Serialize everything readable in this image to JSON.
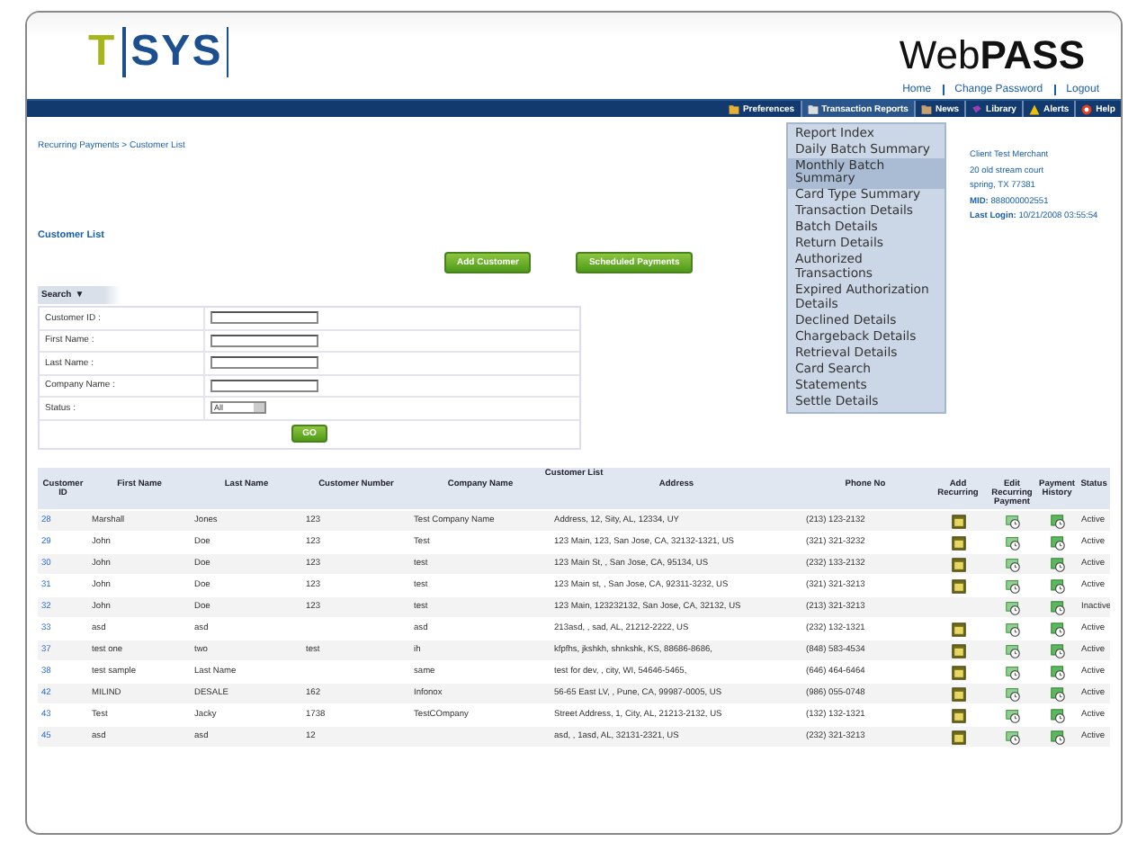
{
  "header": {
    "logo_left": "T",
    "logo_right": "SYS",
    "product": "Web**PASS**",
    "links": [
      "Home",
      "Change Password",
      "Logout"
    ]
  },
  "nav": [
    {
      "label": "Preferences",
      "kind": "prefs",
      "selected": false
    },
    {
      "label": "Transaction Reports",
      "kind": "reports",
      "selected": true
    },
    {
      "label": "News",
      "kind": "news",
      "selected": false
    },
    {
      "label": "Library",
      "kind": "library",
      "selected": false
    },
    {
      "label": "Alerts",
      "kind": "alerts",
      "selected": false
    },
    {
      "label": "Help",
      "kind": "help",
      "selected": false
    }
  ],
  "menu": [
    {
      "label": "Report Index",
      "selected": false
    },
    {
      "label": "Daily Batch Summary",
      "selected": false
    },
    {
      "label": "Monthly Batch Summary",
      "selected": true
    },
    {
      "label": "Card Type Summary",
      "selected": false
    },
    {
      "label": "Transaction Details",
      "selected": false
    },
    {
      "label": "Batch Details",
      "selected": false
    },
    {
      "label": "Return Details",
      "selected": false
    },
    {
      "label": "Authorized Transactions",
      "selected": false
    },
    {
      "label": "Expired Authorization Details",
      "selected": false
    },
    {
      "label": "Declined Details",
      "selected": false
    },
    {
      "label": "Chargeback Details",
      "selected": false
    },
    {
      "label": "Retrieval Details",
      "selected": false
    },
    {
      "label": "Card Search",
      "selected": false
    },
    {
      "label": "Statements",
      "selected": false
    },
    {
      "label": "Settle Details",
      "selected": false
    }
  ],
  "breadcrumb": "Recurring Payments > Customer List",
  "client": [
    {
      "value": "Client Test Merchant"
    },
    {
      "value": "20 old stream court"
    },
    {
      "value": "spring, TX 77381"
    },
    {
      "label": "MID:",
      "value": "888000002551"
    },
    {
      "label": "Last Login:",
      "value": "10/21/2008 03:55:54"
    }
  ],
  "page_title": "Customer List",
  "buttons": [
    "Add Customer",
    "Scheduled Payments"
  ],
  "search": {
    "title": "Search",
    "toggle": "▼",
    "fields": [
      {
        "label": "Customer ID :",
        "kind": "text"
      },
      {
        "label": "First Name :",
        "kind": "text"
      },
      {
        "label": "Last Name :",
        "kind": "text"
      },
      {
        "label": "Company Name :",
        "kind": "text"
      },
      {
        "label": "Status :",
        "kind": "select",
        "value": "All"
      }
    ],
    "submit": "GO"
  },
  "table": {
    "caption": "Customer List",
    "columns": [
      "Customer ID",
      "First Name",
      "Last Name",
      "Customer Number",
      "Company Name",
      "Address",
      "Phone No",
      "Add Recurring",
      "Edit Recurring Payment",
      "Payment History",
      "Status"
    ],
    "rows": [
      {
        "id": "28",
        "first": "Marshall",
        "last": "Jones",
        "number": "123",
        "company": "Test Company Name",
        "address": "Address, 12, Sity, AL, 12334, UY",
        "phone": "(213) 123-2132",
        "add_recurring": true,
        "status": "Active"
      },
      {
        "id": "29",
        "first": "John",
        "last": "Doe",
        "number": "123",
        "company": "Test",
        "address": "123 Main, 123, San Jose, CA, 32132-1321, US",
        "phone": "(321) 321-3232",
        "add_recurring": true,
        "status": "Active"
      },
      {
        "id": "30",
        "first": "John",
        "last": "Doe",
        "number": "123",
        "company": "test",
        "address": "123 Main St, , San Jose, CA, 95134, US",
        "phone": "(232) 133-2132",
        "add_recurring": true,
        "status": "Active"
      },
      {
        "id": "31",
        "first": "John",
        "last": "Doe",
        "number": "123",
        "company": "test",
        "address": "123 Main st, , San Jose, CA, 92311-3232, US",
        "phone": "(321) 321-3213",
        "add_recurring": true,
        "status": "Active"
      },
      {
        "id": "32",
        "first": "John",
        "last": "Doe",
        "number": "123",
        "company": "test",
        "address": "123 Main, 123232132, San Jose, CA, 32132, US",
        "phone": "(213) 321-3213",
        "add_recurring": false,
        "status": "Inactive"
      },
      {
        "id": "33",
        "first": "asd",
        "last": "asd",
        "number": "",
        "company": "asd",
        "address": "213asd, , sad, AL, 21212-2222, US",
        "phone": "(232) 132-1321",
        "add_recurring": true,
        "status": "Active"
      },
      {
        "id": "37",
        "first": "test one",
        "last": "two",
        "number": "test",
        "company": "ih",
        "address": "kfpfhs, jkshkh, shnkshk, KS, 88686-8686,",
        "phone": "(848) 583-4534",
        "add_recurring": true,
        "status": "Active"
      },
      {
        "id": "38",
        "first": "test sample",
        "last": "Last Name",
        "number": "",
        "company": "same",
        "address": "test for dev, , city, WI, 54646-5465,",
        "phone": "(646) 464-6464",
        "add_recurring": true,
        "status": "Active"
      },
      {
        "id": "42",
        "first": "MILIND",
        "last": "DESALE",
        "number": "162",
        "company": "Infonox",
        "address": "56-65 East LV, , Pune, CA, 99987-0005, US",
        "phone": "(986) 055-0748",
        "add_recurring": true,
        "status": "Active"
      },
      {
        "id": "43",
        "first": "Test",
        "last": "Jacky",
        "number": "1738",
        "company": "TestCOmpany",
        "address": "Street Address, 1, City, AL, 21213-2132, US",
        "phone": "(132) 132-1321",
        "add_recurring": true,
        "status": "Active"
      },
      {
        "id": "45",
        "first": "asd",
        "last": "asd",
        "number": "12",
        "company": "",
        "address": "asd, , 1asd, AL, 32131-2321, US",
        "phone": "(232) 321-3213",
        "add_recurring": true,
        "status": "Active"
      }
    ]
  }
}
